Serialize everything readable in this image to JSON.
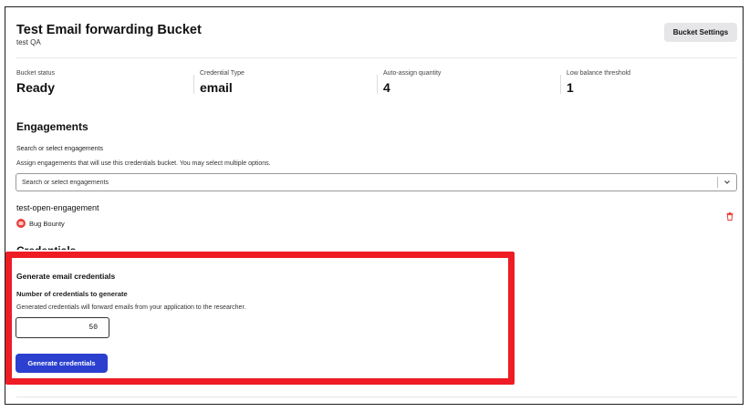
{
  "header": {
    "title": "Test Email forwarding Bucket",
    "subtitle": "test QA",
    "settings_button": "Bucket Settings"
  },
  "stats": [
    {
      "label": "Bucket status",
      "value": "Ready"
    },
    {
      "label": "Credential Type",
      "value": "email"
    },
    {
      "label": "Auto-assign quantity",
      "value": "4"
    },
    {
      "label": "Low balance threshold",
      "value": "1"
    }
  ],
  "engagements": {
    "title": "Engagements",
    "field_label": "Search or select engagements",
    "help_text": "Assign engagements that will use this credentials bucket. You may select multiple options.",
    "search_placeholder": "Search or select engagements",
    "items": [
      {
        "name": "test-open-engagement",
        "type": "Bug Bounty"
      }
    ]
  },
  "credentials": {
    "title": "Credentials",
    "generate_title": "Generate email credentials",
    "count_label": "Number of credentials to generate",
    "help_text": "Generated credentials will forward emails from your application to the researcher.",
    "count_value": "50",
    "generate_button": "Generate credentials"
  },
  "colors": {
    "primary_button": "#2b40cf",
    "highlight_border": "#ee1c24",
    "delete_icon": "#e8413c"
  },
  "icons": [
    "chevron-down-icon",
    "bug-bounty-icon",
    "trash-icon"
  ]
}
